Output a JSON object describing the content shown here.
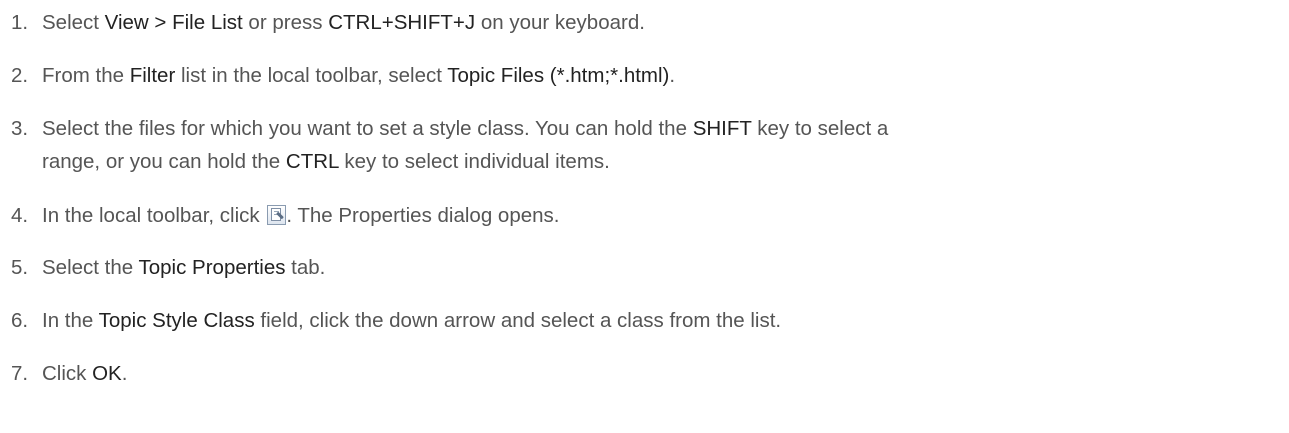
{
  "steps": [
    {
      "number": "1.",
      "parts": [
        {
          "t": "Select ",
          "b": false
        },
        {
          "t": "View > File List",
          "b": true
        },
        {
          "t": " or press ",
          "b": false
        },
        {
          "t": "CTRL+SHIFT+J",
          "b": true
        },
        {
          "t": " on your keyboard.",
          "b": false
        }
      ]
    },
    {
      "number": "2.",
      "parts": [
        {
          "t": "From the ",
          "b": false
        },
        {
          "t": "Filter",
          "b": true
        },
        {
          "t": " list in the local toolbar, select ",
          "b": false
        },
        {
          "t": "Topic Files (*.htm;*.html)",
          "b": true
        },
        {
          "t": ".",
          "b": false
        }
      ]
    },
    {
      "number": "3.",
      "line1": [
        {
          "t": "Select the files for which you want to set a style class. You can hold the ",
          "b": false
        },
        {
          "t": "SHIFT",
          "b": true
        },
        {
          "t": " key to select a",
          "b": false
        }
      ],
      "line2": [
        {
          "t": "range, or you can hold the ",
          "b": false
        },
        {
          "t": "CTRL",
          "b": true
        },
        {
          "t": " key to select individual items.",
          "b": false
        }
      ]
    },
    {
      "number": "4.",
      "before_icon": "In the local toolbar, click ",
      "icon": "properties-icon",
      "after_icon": ". The Properties dialog opens."
    },
    {
      "number": "5.",
      "parts": [
        {
          "t": "Select the ",
          "b": false
        },
        {
          "t": "Topic Properties",
          "b": true
        },
        {
          "t": " tab.",
          "b": false
        }
      ]
    },
    {
      "number": "6.",
      "parts": [
        {
          "t": "In the ",
          "b": false
        },
        {
          "t": "Topic Style Class",
          "b": true
        },
        {
          "t": " field, click the down arrow and select a class from the list.",
          "b": false
        }
      ]
    },
    {
      "number": "7.",
      "parts": [
        {
          "t": "Click ",
          "b": false
        },
        {
          "t": "OK",
          "b": true
        },
        {
          "t": ".",
          "b": false
        }
      ]
    }
  ]
}
